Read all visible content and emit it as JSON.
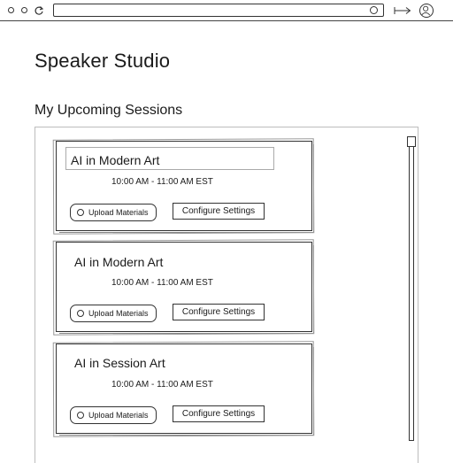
{
  "app": {
    "title": "Speaker Studio",
    "section_title": "My Upcoming Sessions"
  },
  "sessions": [
    {
      "title": "AI in Modern Art",
      "time": "10:00 AM - 11:00 AM EST",
      "upload_label": "Upload Materials",
      "configure_label": "Configure Settings"
    },
    {
      "title": "AI in Modern Art",
      "time": "10:00 AM - 11:00 AM EST",
      "upload_label": "Upload Materials",
      "configure_label": "Configure Settings"
    },
    {
      "title": "AI in Session Art",
      "time": "10:00 AM - 11:00 AM EST",
      "upload_label": "Upload Materials",
      "configure_label": "Configure Settings"
    }
  ]
}
